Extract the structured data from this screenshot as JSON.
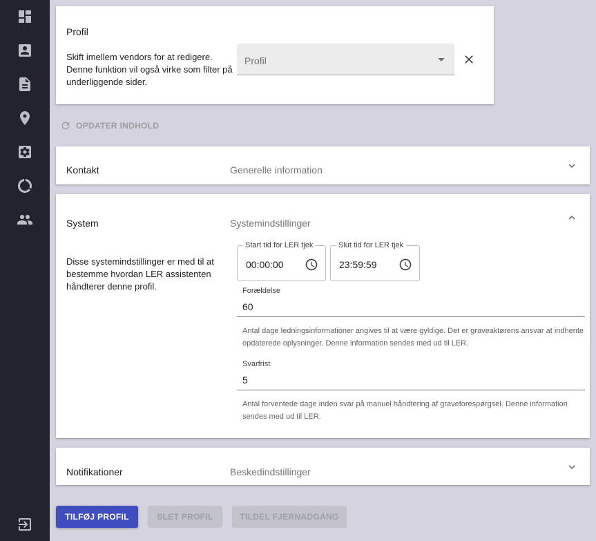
{
  "sidebar": {
    "items": [
      {
        "icon": "dashboard-icon"
      },
      {
        "icon": "account-box-icon"
      },
      {
        "icon": "document-icon"
      },
      {
        "icon": "location-pin-icon"
      },
      {
        "icon": "settings-box-icon"
      },
      {
        "icon": "progress-circle-icon"
      },
      {
        "icon": "people-icon"
      }
    ],
    "logout_icon": "logout-icon"
  },
  "profile_card": {
    "title": "Profil",
    "description": "Skift imellem vendors for at redigere. Denne funktion vil også virke som filter på underliggende sider.",
    "select": {
      "value": "Profil"
    }
  },
  "refresh_label": "OPDATER INDHOLD",
  "panels": {
    "kontakt": {
      "title": "Kontakt",
      "subtitle": "Generelle information"
    },
    "system": {
      "title": "System",
      "subtitle": "Systemindstillinger",
      "description": "Disse systemindstillinger er med til at bestemme hvordan LER assistenten håndterer denne profil.",
      "start_time": {
        "label": "Start tid for LER tjek",
        "value": "00:00:00"
      },
      "end_time": {
        "label": "Slut tid for LER tjek",
        "value": "23:59:59"
      },
      "foraeldelse": {
        "label": "Forældelse",
        "value": "60",
        "hint": "Antal dage ledningsinformationer angives til at være gyldige. Det er graveaktørens ansvar at indhente opdaterede oplysninger. Denne information sendes med ud til LER."
      },
      "svarfrist": {
        "label": "Svarfrist",
        "value": "5",
        "hint": "Antal forventede dage inden svar på manuel håndtering af graveforespørgsel. Denne information sendes med ud til LER."
      }
    },
    "notifikationer": {
      "title": "Notifikationer",
      "subtitle": "Beskedindstillinger"
    }
  },
  "buttons": {
    "add": "TILFØJ PROFIL",
    "delete": "SLET PROFIL",
    "remote": "TILDEL FJERNADGANG"
  },
  "colors": {
    "primary": "#3f4dbf",
    "sidebar": "#22232e",
    "background": "#d4d3df"
  }
}
